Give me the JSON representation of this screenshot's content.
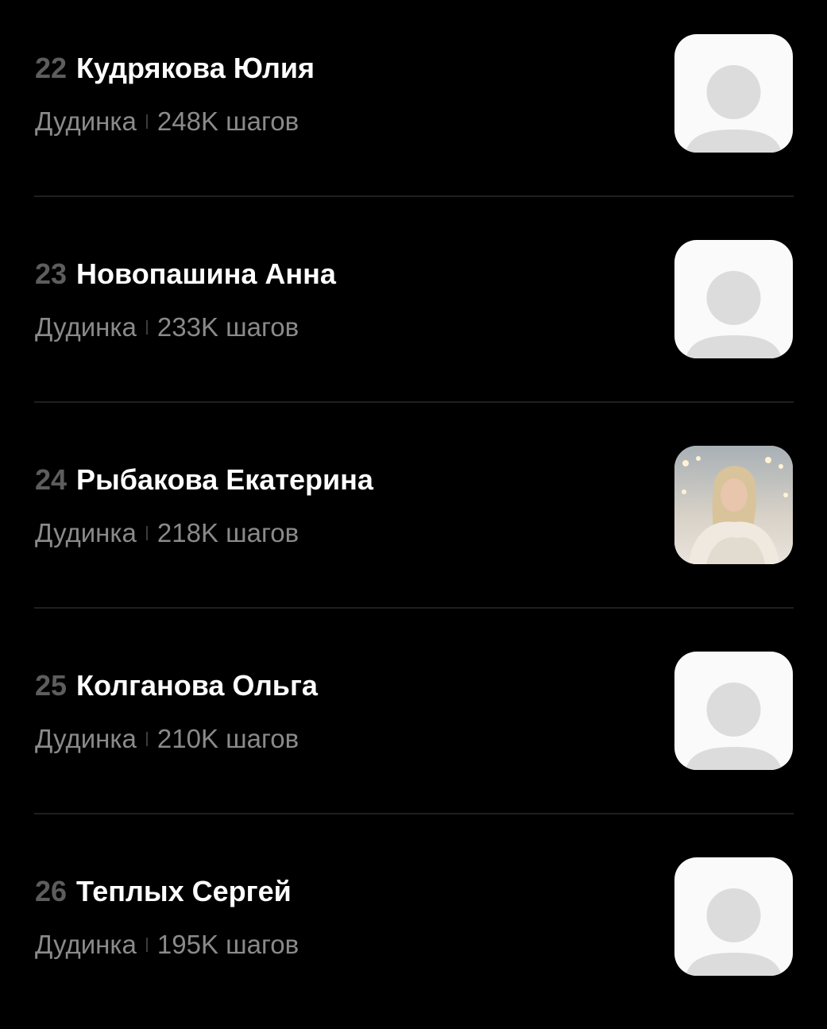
{
  "leaderboard": {
    "rows": [
      {
        "rank": "22",
        "name": "Кудрякова Юлия",
        "city": "Дудинка",
        "steps": "248K шагов",
        "avatar": "placeholder-avatar-icon"
      },
      {
        "rank": "23",
        "name": "Новопашина Анна",
        "city": "Дудинка",
        "steps": "233K шагов",
        "avatar": "placeholder-avatar-icon"
      },
      {
        "rank": "24",
        "name": "Рыбакова Екатерина",
        "city": "Дудинка",
        "steps": "218K шагов",
        "avatar": "profile-photo"
      },
      {
        "rank": "25",
        "name": "Колганова Ольга",
        "city": "Дудинка",
        "steps": "210K шагов",
        "avatar": "placeholder-avatar-icon"
      },
      {
        "rank": "26",
        "name": "Теплых Сергей",
        "city": "Дудинка",
        "steps": "195K шагов",
        "avatar": "placeholder-avatar-icon"
      }
    ]
  },
  "colors": {
    "background": "#000000",
    "name": "#ffffff",
    "rank": "#5d5d5d",
    "subtext": "#8a8a8a",
    "divider": "#1f1f1f",
    "avatar_bg": "#fafafa",
    "avatar_silhouette": "#dcdcdc"
  }
}
